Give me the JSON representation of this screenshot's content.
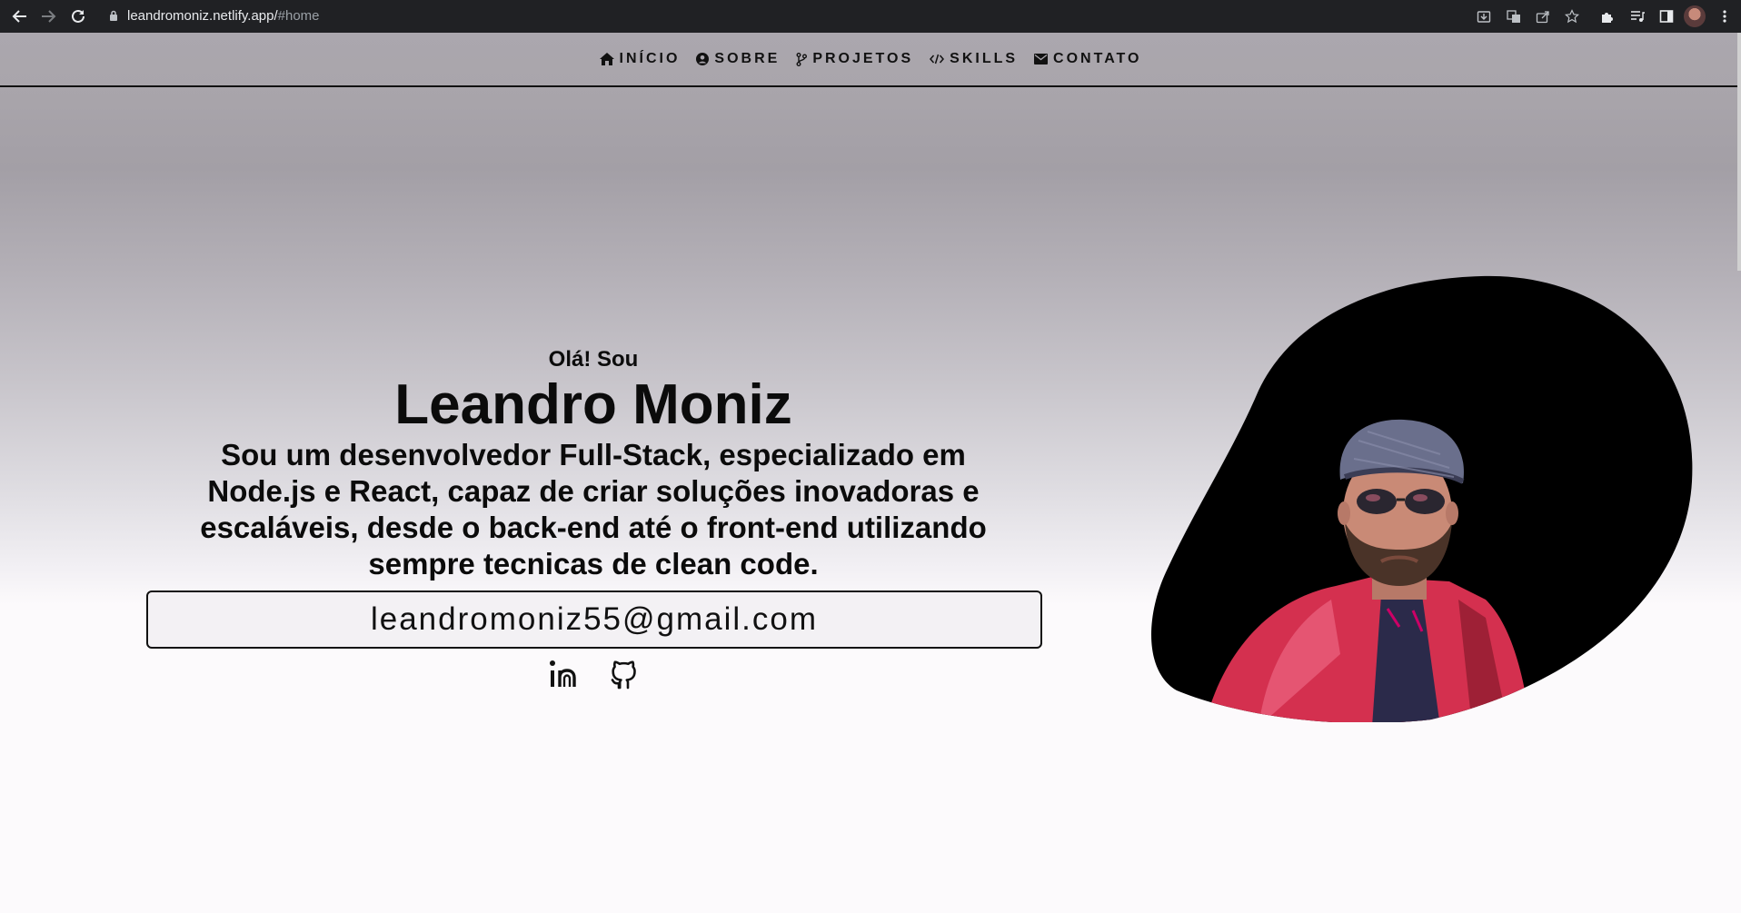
{
  "browser": {
    "url_host": "leandromoniz.netlify.app/",
    "url_path": "#home"
  },
  "nav": {
    "items": [
      {
        "label": "INÍCIO",
        "icon": "home-icon"
      },
      {
        "label": "SOBRE",
        "icon": "user-circle-icon"
      },
      {
        "label": "PROJETOS",
        "icon": "git-branch-icon"
      },
      {
        "label": "SKILLS",
        "icon": "code-icon"
      },
      {
        "label": "CONTATO",
        "icon": "envelope-icon"
      }
    ]
  },
  "hero": {
    "greeting": "Olá! Sou",
    "name": "Leandro Moniz",
    "description": "Sou um desenvolvedor Full-Stack, especializado em Node.js e React, capaz de criar soluções inovadoras e escaláveis, desde o back-end até o front-end utilizando sempre tecnicas de clean code.",
    "email": "leandromoniz55@gmail.com"
  },
  "socials": [
    "linkedin-icon",
    "github-icon"
  ],
  "colors": {
    "chrome": "#202124",
    "text": "#111111",
    "blob": "#000000",
    "jacket": "#d4304f"
  }
}
